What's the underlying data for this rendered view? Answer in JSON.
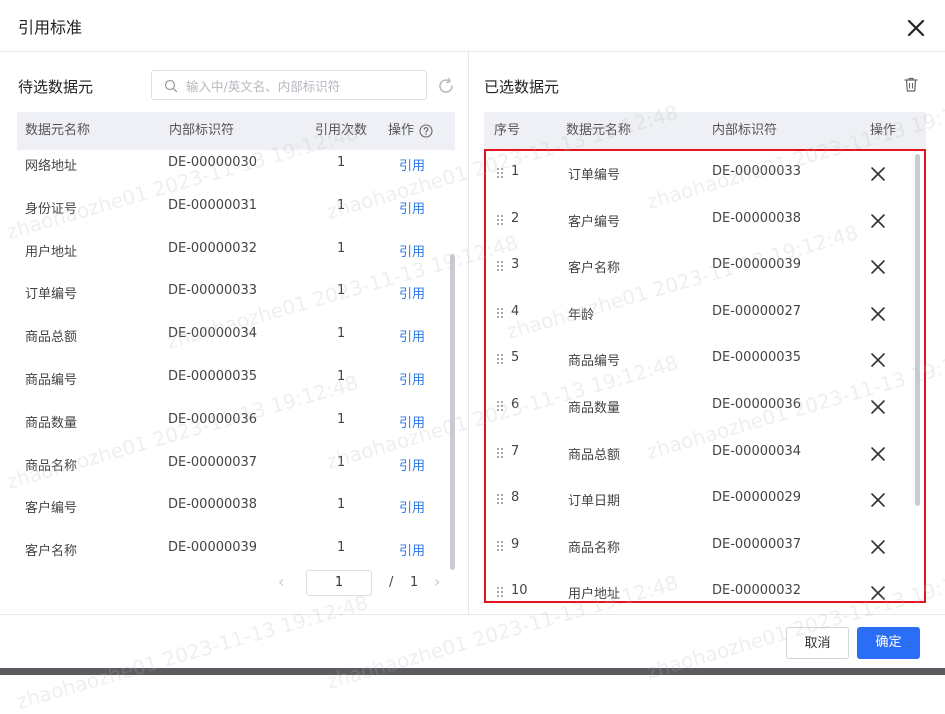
{
  "dialog": {
    "title": "引用标准"
  },
  "left_panel": {
    "title": "待选数据元",
    "search": {
      "placeholder": "输入中/英文名、内部标识符",
      "value": ""
    },
    "columns": [
      "数据元名称",
      "内部标识符",
      "引用次数",
      "操作"
    ],
    "rows": [
      {
        "name": "网络地址",
        "id": "DE-00000030",
        "count": "1",
        "action": "引用"
      },
      {
        "name": "身份证号",
        "id": "DE-00000031",
        "count": "1",
        "action": "引用"
      },
      {
        "name": "用户地址",
        "id": "DE-00000032",
        "count": "1",
        "action": "引用"
      },
      {
        "name": "订单编号",
        "id": "DE-00000033",
        "count": "1",
        "action": "引用"
      },
      {
        "name": "商品总额",
        "id": "DE-00000034",
        "count": "1",
        "action": "引用"
      },
      {
        "name": "商品编号",
        "id": "DE-00000035",
        "count": "1",
        "action": "引用"
      },
      {
        "name": "商品数量",
        "id": "DE-00000036",
        "count": "1",
        "action": "引用"
      },
      {
        "name": "商品名称",
        "id": "DE-00000037",
        "count": "1",
        "action": "引用"
      },
      {
        "name": "客户编号",
        "id": "DE-00000038",
        "count": "1",
        "action": "引用"
      },
      {
        "name": "客户名称",
        "id": "DE-00000039",
        "count": "1",
        "action": "引用"
      }
    ],
    "pager": {
      "current": "1",
      "separator": "/",
      "total": "1",
      "prev": "‹",
      "next": "›"
    }
  },
  "right_panel": {
    "title": "已选数据元",
    "columns": [
      "序号",
      "数据元名称",
      "内部标识符",
      "操作"
    ],
    "rows": [
      {
        "no": "1",
        "name": "订单编号",
        "id": "DE-00000033"
      },
      {
        "no": "2",
        "name": "客户编号",
        "id": "DE-00000038"
      },
      {
        "no": "3",
        "name": "客户名称",
        "id": "DE-00000039"
      },
      {
        "no": "4",
        "name": "年龄",
        "id": "DE-00000027"
      },
      {
        "no": "5",
        "name": "商品编号",
        "id": "DE-00000035"
      },
      {
        "no": "6",
        "name": "商品数量",
        "id": "DE-00000036"
      },
      {
        "no": "7",
        "name": "商品总额",
        "id": "DE-00000034"
      },
      {
        "no": "8",
        "name": "订单日期",
        "id": "DE-00000029"
      },
      {
        "no": "9",
        "name": "商品名称",
        "id": "DE-00000037"
      },
      {
        "no": "10",
        "name": "用户地址",
        "id": "DE-00000032"
      }
    ]
  },
  "footer": {
    "cancel_label": "取消",
    "ok_label": "确定"
  },
  "watermark": "zhaohaozhe01 2023-11-13 19:12:48",
  "colors": {
    "link": "#2a78e4",
    "primary": "#2a6ef5",
    "highlight_border": "#e3141e",
    "header_bg": "#eef0f5"
  },
  "icons": {
    "close": "close-icon",
    "search": "search-icon",
    "refresh": "refresh-icon",
    "help": "help-circle-icon",
    "delete": "trash-icon",
    "drag": "drag-handle-icon",
    "remove": "x-icon"
  }
}
